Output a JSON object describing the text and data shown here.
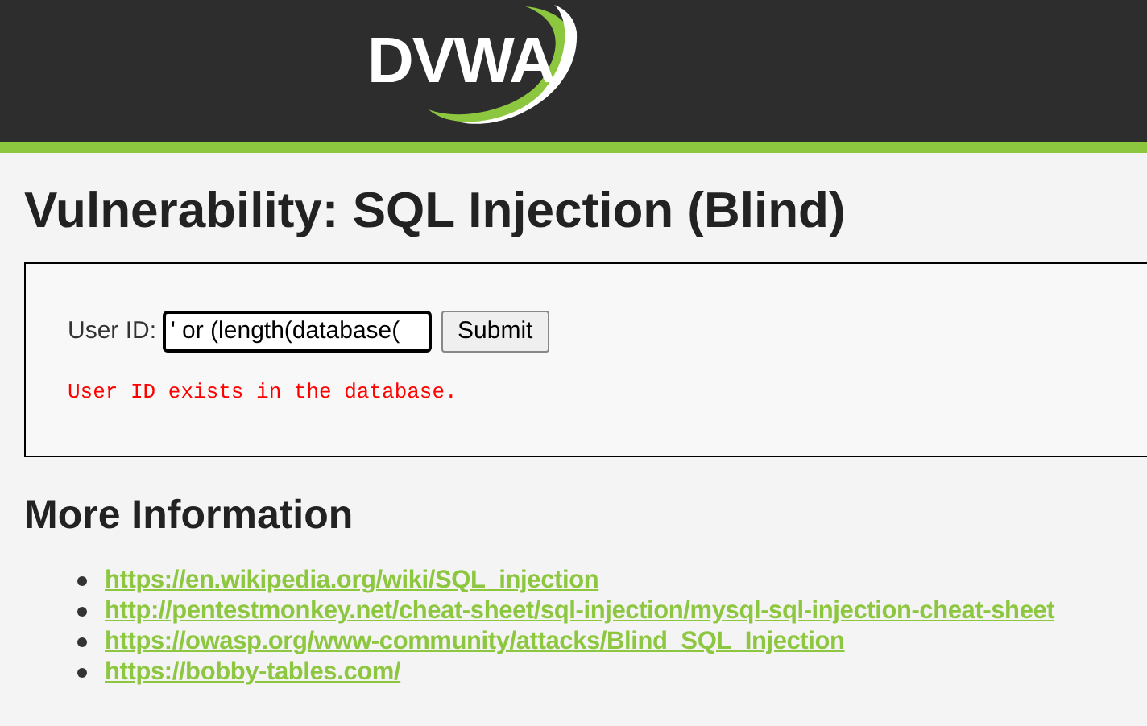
{
  "header": {
    "logo": "DVWA"
  },
  "title": "Vulnerability: SQL Injection (Blind)",
  "form": {
    "label": "User ID:",
    "value": "' or (length(database(",
    "button": "Submit",
    "message": "User ID exists in the database."
  },
  "more_info": {
    "heading": "More Information",
    "links": [
      "https://en.wikipedia.org/wiki/SQL_injection",
      "http://pentestmonkey.net/cheat-sheet/sql-injection/mysql-sql-injection-cheat-sheet",
      "https://owasp.org/www-community/attacks/Blind_SQL_Injection",
      "https://bobby-tables.com/"
    ]
  }
}
